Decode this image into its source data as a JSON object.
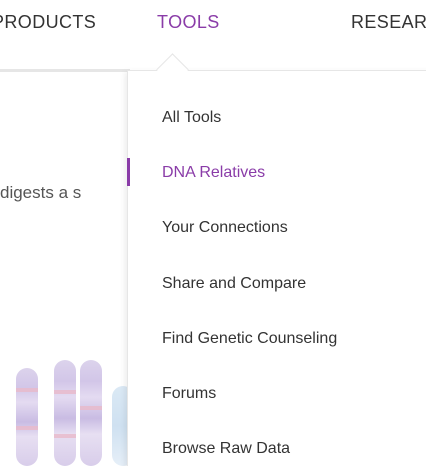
{
  "colors": {
    "accent": "#8a3ca8",
    "text": "#333333",
    "divider": "#e6e6e6"
  },
  "nav": {
    "items": [
      {
        "label": "PRODUCTS"
      },
      {
        "label": "TOOLS"
      },
      {
        "label": "RESEARCH"
      }
    ],
    "active": "TOOLS"
  },
  "background": {
    "snippet": "digests a s"
  },
  "tools_menu": {
    "items": [
      {
        "label": "All Tools"
      },
      {
        "label": "DNA Relatives"
      },
      {
        "label": "Your Connections"
      },
      {
        "label": "Share and Compare"
      },
      {
        "label": "Find Genetic Counseling"
      },
      {
        "label": "Forums"
      },
      {
        "label": "Browse Raw Data"
      }
    ],
    "active": "DNA Relatives"
  }
}
